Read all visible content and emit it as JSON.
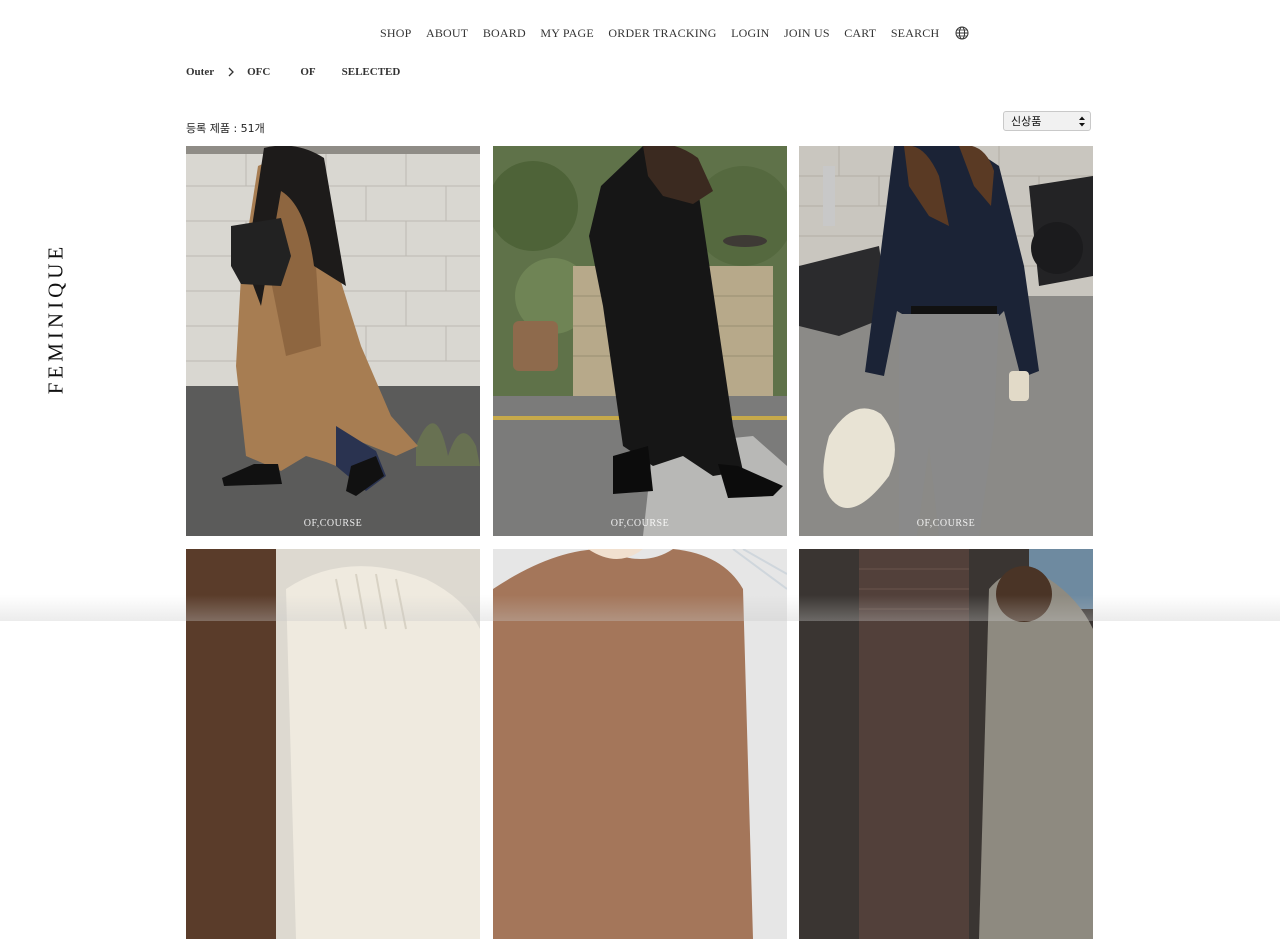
{
  "brand": {
    "logo_text": "FEMINIQUE"
  },
  "nav": {
    "items": [
      "SHOP",
      "ABOUT",
      "BOARD",
      "MY PAGE",
      "ORDER TRACKING",
      "LOGIN",
      "JOIN US",
      "CART",
      "SEARCH"
    ],
    "language_icon": "globe-icon"
  },
  "breadcrumb": {
    "root": "Outer",
    "chevron_icon": "chevron-right-icon",
    "filters": [
      "OFC",
      "OF",
      "SELECTED"
    ]
  },
  "listing": {
    "count_label": "등록 제품 : 51개"
  },
  "sort": {
    "selected": "신상품"
  },
  "products": {
    "watermark": "OF,COURSE",
    "items": [
      {
        "image": "camel-wrap-coat-photo",
        "has_watermark": true
      },
      {
        "image": "black-long-coat-photo",
        "has_watermark": true
      },
      {
        "image": "navy-knit-cardigan-photo",
        "has_watermark": true
      },
      {
        "image": "ivory-knit-photo",
        "has_watermark": false
      },
      {
        "image": "camel-knit-cardigan-photo",
        "has_watermark": false
      },
      {
        "image": "grey-jacket-street-photo",
        "has_watermark": false
      }
    ]
  },
  "colors": {
    "text": "#222222",
    "sort_bg": "#f1f1f1",
    "camel": "#a77d52",
    "black": "#161616",
    "navy": "#1b2336",
    "grey_pants": "#8a8a8a"
  }
}
